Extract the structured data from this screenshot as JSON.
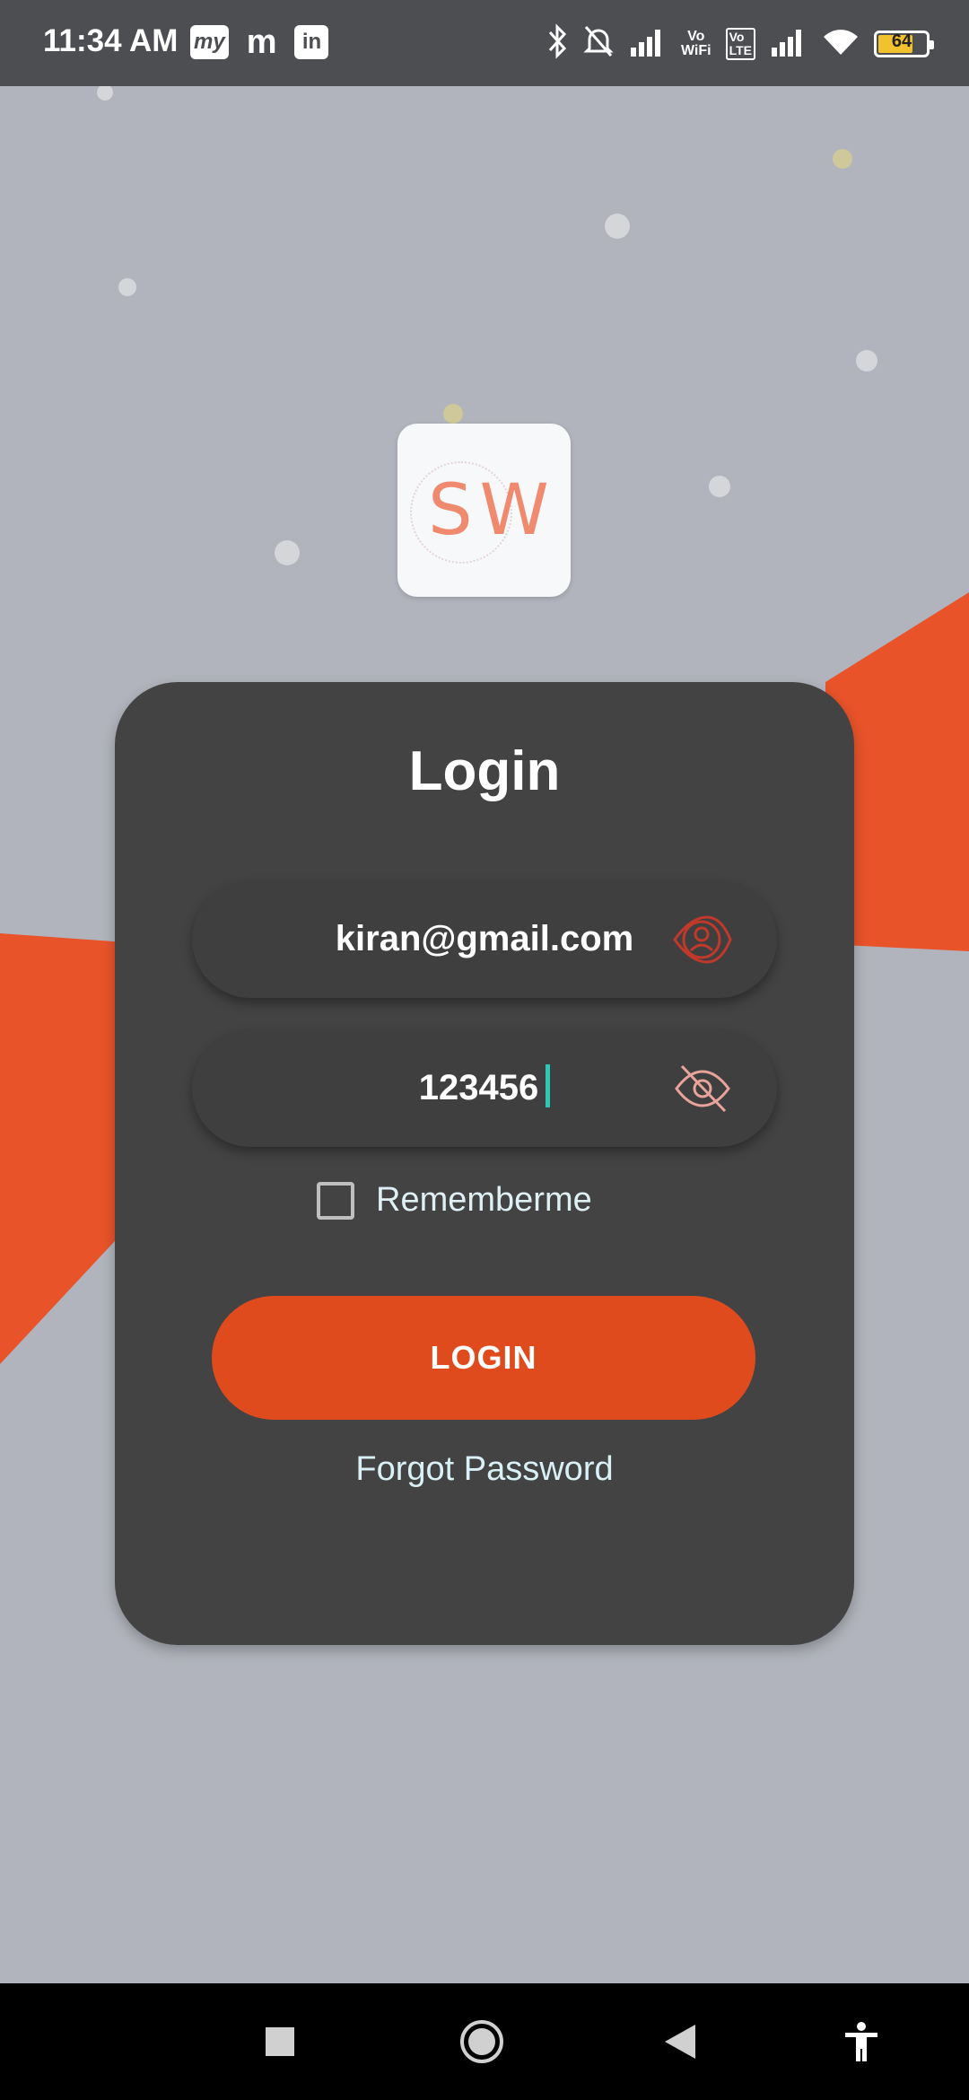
{
  "status_bar": {
    "time": "11:34 AM",
    "notification_icons": [
      "myntra-icon",
      "m-app-icon",
      "linkedin-icon"
    ],
    "notification_labels": [
      "my",
      "m",
      "in"
    ],
    "system_icons": [
      "bluetooth-icon",
      "mute-icon",
      "signal-icon",
      "vowifi-icon",
      "volte-icon",
      "signal-icon-2",
      "wifi-icon"
    ],
    "battery_level": "64"
  },
  "logo": {
    "text": "SW"
  },
  "login_card": {
    "title": "Login",
    "email_value": "kiran@gmail.com",
    "password_value": "123456",
    "remember_label": "Rememberme",
    "remember_checked": false,
    "login_button": "LOGIN",
    "forgot_link": "Forgot Password"
  },
  "colors": {
    "accent": "#e04b1e",
    "card": "#434343",
    "background": "#b1b4bc",
    "caret": "#2ec6b5"
  },
  "nav_bar": {
    "buttons": [
      "recents-square-icon",
      "home-circle-icon",
      "back-triangle-icon",
      "accessibility-icon"
    ]
  }
}
